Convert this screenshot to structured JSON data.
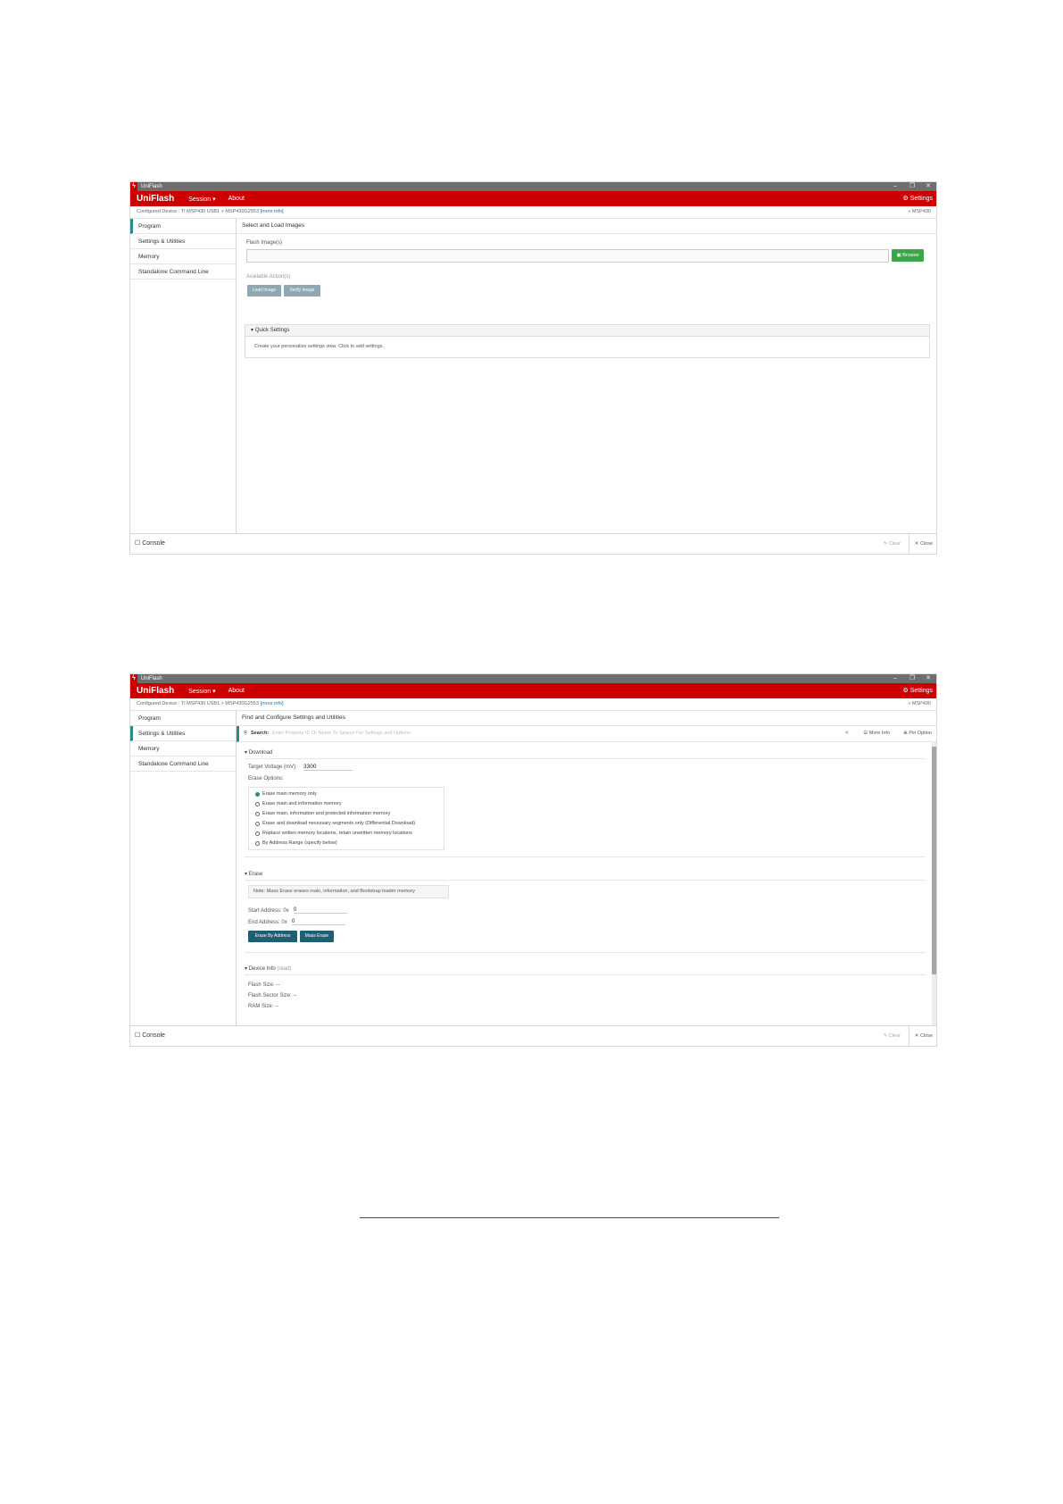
{
  "app": {
    "window_title": "UniFlash",
    "brand": "UniFlash",
    "menu_session": "Session ▾",
    "menu_about": "About",
    "settings": "Settings",
    "minimize": "–",
    "restore": "❐",
    "close": "✕"
  },
  "breadcrumb": {
    "configured": "Configured Device : TI MSP430 USB1",
    "sep": ">",
    "device": "MSP430G2553",
    "more_info": "[more info]",
    "family": "» MSP430"
  },
  "nav": [
    "Program",
    "Settings & Utilities",
    "Memory",
    "Standalone Command Line"
  ],
  "screen1": {
    "title": "Select and Load Images",
    "flash_label": "Flash Image(s)",
    "browse": "Browse",
    "actions_label": "Available Action(s)",
    "load_image": "Load Image",
    "verify_image": "Verify Image",
    "quick_settings": "Quick Settings",
    "quick_text": "Create your personalize settings view. Click to add settings."
  },
  "screen2": {
    "title": "Find and Configure Settings and Utilities",
    "search_label": "Search:",
    "search_placeholder": "Enter Property ID Or Name To Search For Settings and Options",
    "clear_search": "✕",
    "more_info": "More Info",
    "pin_option": "Pin Option",
    "download_section": "Download",
    "target_voltage_label": "Target Voltage (mV):",
    "target_voltage_value": "3300",
    "erase_options_label": "Erase Options:",
    "erase_options": [
      "Erase main memory only",
      "Erase main and information memory",
      "Erase main, information and protected information memory",
      "Erase and download necessary segments only (Differential Download)",
      "Replace written memory locations, retain unwritten memory locations",
      "By Address Range (specify below)"
    ],
    "selected_option": 0,
    "erase_section": "Erase",
    "note": "Note: Mass Erase erases main, information, and Bootstrap loader memory",
    "start_address_label": "Start Address: 0x",
    "start_address_value": "0",
    "end_address_label": "End Address: 0x",
    "end_address_value": "0",
    "erase_by_address": "Erase By Address",
    "mass_erase": "Mass Erase",
    "device_info_section": "Device Info",
    "device_info_read": "(read)",
    "flash_size": "Flash Size: --",
    "flash_sector_size": "Flash Sector Size: --",
    "ram_size": "RAM Size: --"
  },
  "console": {
    "label": "Console",
    "clear": "Clear",
    "close": "Close"
  },
  "colors": {
    "brand_red": "#cc0000",
    "teal_accent": "#2a8b8b",
    "browse_green": "#3aa84a",
    "action_grey": "#8ea7b2",
    "dark_teal_button": "#1f5f73"
  }
}
